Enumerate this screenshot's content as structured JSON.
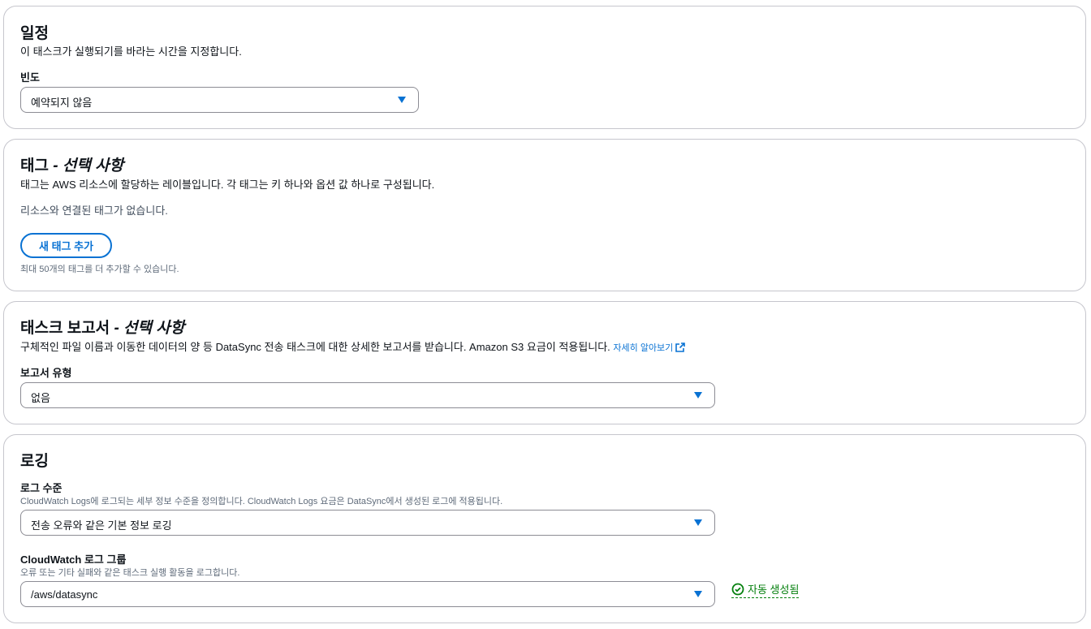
{
  "schedule": {
    "title": "일정",
    "description": "이 태스크가 실행되기를 바라는 시간을 지정합니다.",
    "frequency_label": "빈도",
    "frequency_value": "예약되지 않음"
  },
  "tags": {
    "title": "태그",
    "title_optional": "- 선택 사항",
    "description": "태그는 AWS 리소스에 할당하는 레이블입니다. 각 태그는 키 하나와 옵션 값 하나로 구성됩니다.",
    "empty_text": "리소스와 연결된 태그가 없습니다.",
    "add_button": "새 태그 추가",
    "limit_text": "최대 50개의 태그를 더 추가할 수 있습니다."
  },
  "task_report": {
    "title": "태스크 보고서",
    "title_optional": "- 선택 사항",
    "description": "구체적인 파일 이름과 이동한 데이터의 양 등 DataSync 전송 태스크에 대한 상세한 보고서를 받습니다. Amazon S3 요금이 적용됩니다.",
    "learn_more": "자세히 알아보기",
    "report_type_label": "보고서 유형",
    "report_type_value": "없음"
  },
  "logging": {
    "title": "로깅",
    "log_level_label": "로그 수준",
    "log_level_description": "CloudWatch Logs에 로그되는 세부 정보 수준을 정의합니다. CloudWatch Logs 요금은 DataSync에서 생성된 로그에 적용됩니다.",
    "log_level_value": "전송 오류와 같은 기본 정보 로깅",
    "log_group_label": "CloudWatch 로그 그룹",
    "log_group_description": "오류 또는 기타 실패와 같은 태스크 실행 활동을 로그합니다.",
    "log_group_value": "/aws/datasync",
    "status_text": "자동 생성됨"
  },
  "colors": {
    "link": "#0972d3",
    "success": "#037f0c",
    "border": "#c6c6cd"
  },
  "icons": [
    "chevron-down-icon",
    "external-link-icon",
    "check-circle-icon"
  ]
}
